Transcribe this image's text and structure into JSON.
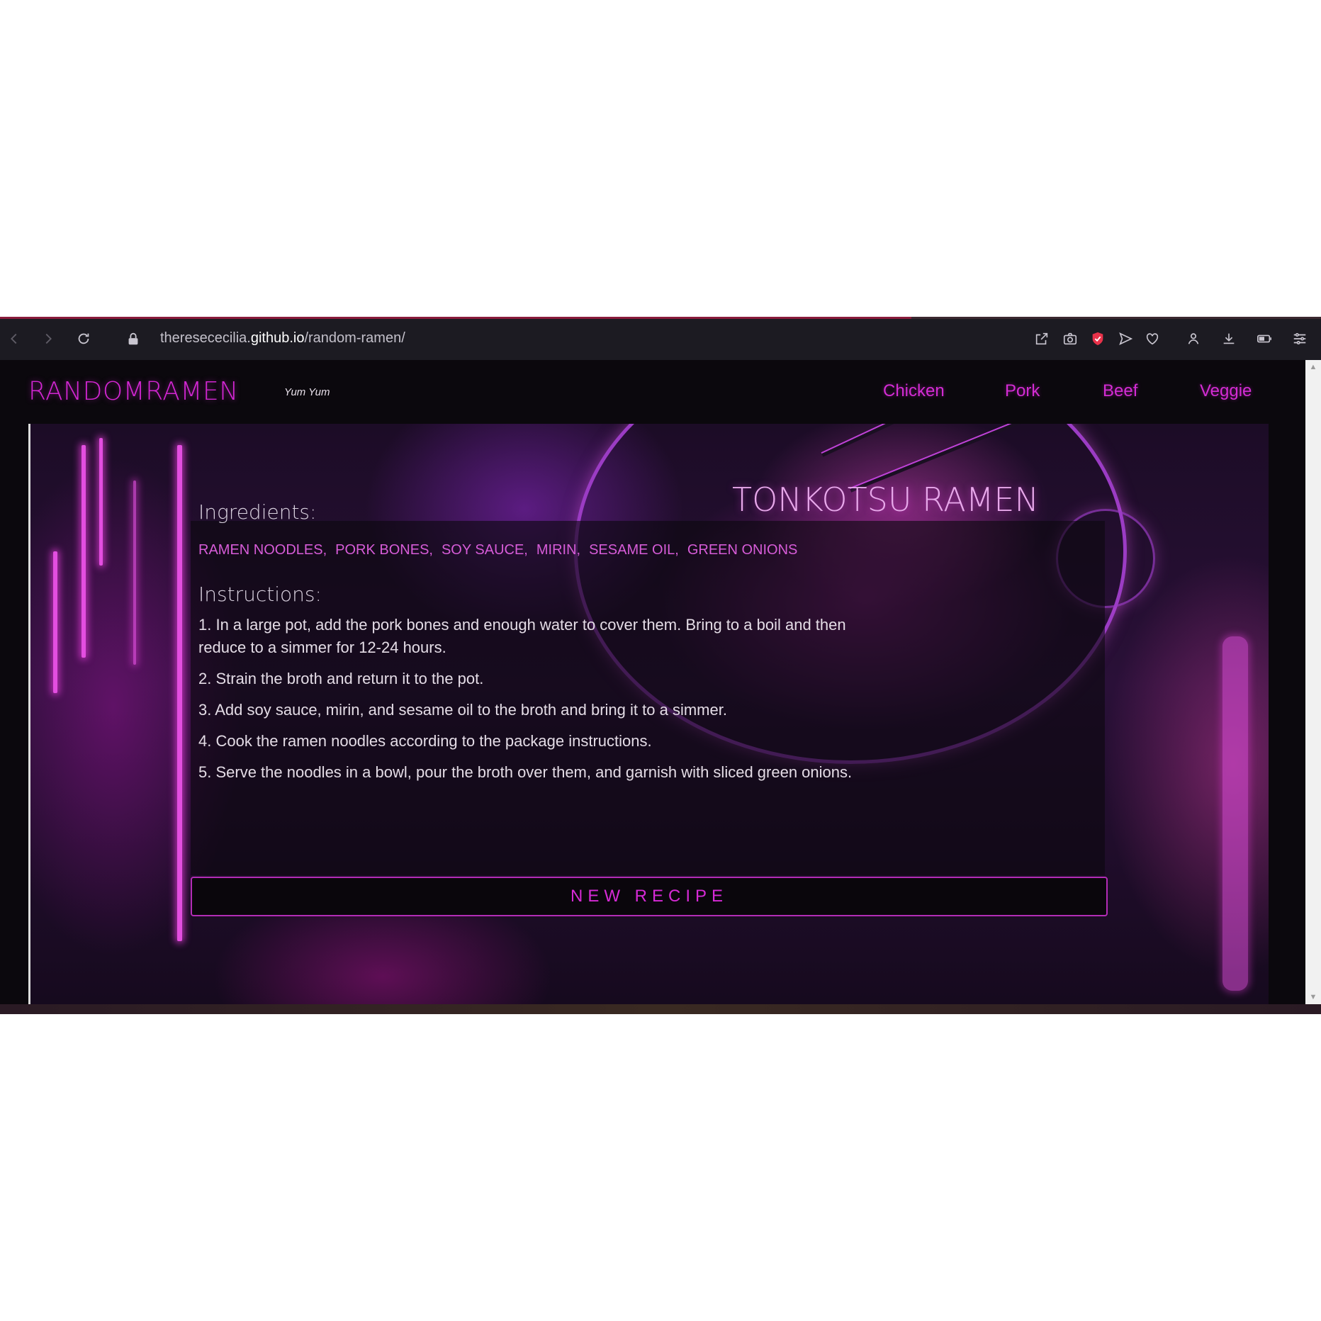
{
  "browser": {
    "url_prefix": "theresececilia.",
    "url_host": "github.io",
    "url_path": "/random-ramen/"
  },
  "site": {
    "brand": "RANDOMRAMEN",
    "tagline": "Yum Yum",
    "nav": [
      "Chicken",
      "Pork",
      "Beef",
      "Veggie"
    ]
  },
  "recipe": {
    "title": "TONKOTSU RAMEN",
    "ingredients_heading": "Ingredients:",
    "ingredients": [
      "RAMEN NOODLES,",
      "PORK BONES,",
      "SOY SAUCE,",
      "MIRIN,",
      "SESAME OIL,",
      "GREEN ONIONS"
    ],
    "instructions_heading": "Instructions:",
    "steps": [
      "1. In a large pot, add the pork bones and enough water to cover them. Bring to a boil and then reduce to a simmer for 12-24 hours.",
      "2. Strain the broth and return it to the pot.",
      "3. Add soy sauce, mirin, and sesame oil to the broth and bring it to a simmer.",
      "4. Cook the ramen noodles according to the package instructions.",
      "5. Serve the noodles in a bowl, pour the broth over them, and garnish with sliced green onions."
    ],
    "button_label": "NEW RECIPE"
  },
  "colors": {
    "accent": "#d42cd4",
    "background": "#0b080d"
  }
}
